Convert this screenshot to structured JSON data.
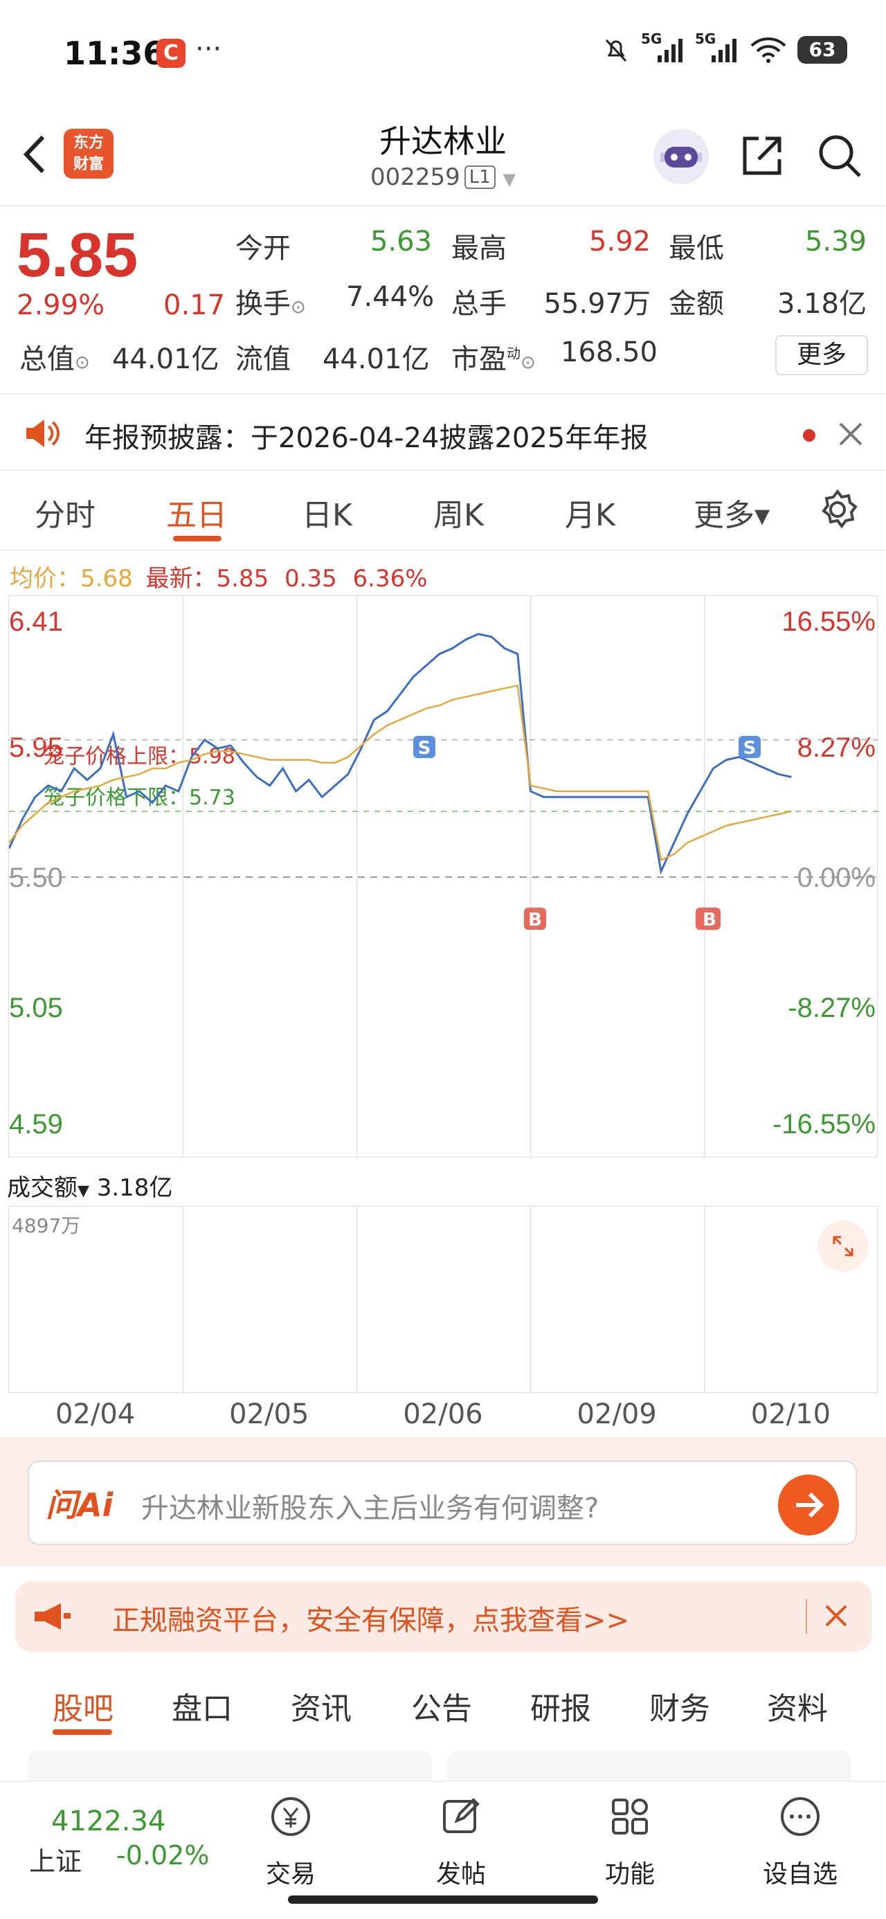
{
  "status_bar": {
    "time": "11:36",
    "app_badge": "C",
    "more": "···",
    "signal_1": "5G",
    "signal_2": "5G",
    "battery": "63"
  },
  "header": {
    "title": "升达林业",
    "code": "002259",
    "level": "L1",
    "logo_line1": "东方",
    "logo_line2": "财富"
  },
  "quote": {
    "price": "5.85",
    "change_pct": "2.99%",
    "change": "0.17",
    "rows": [
      [
        {
          "label": "今开",
          "value": "5.63",
          "color": "green"
        },
        {
          "label": "最高",
          "value": "5.92",
          "color": "red"
        },
        {
          "label": "最低",
          "value": "5.39",
          "color": "green"
        }
      ],
      [
        {
          "label": "换手",
          "value": "7.44%",
          "color": "dark"
        },
        {
          "label": "总手",
          "value": "55.97万",
          "color": "dark"
        },
        {
          "label": "金额",
          "value": "3.18亿",
          "color": "dark"
        }
      ]
    ],
    "total_mv_label": "总值",
    "total_mv": "44.01亿",
    "float_mv_label": "流值",
    "float_mv": "44.01亿",
    "pe_label": "市盈",
    "pe_sup": "动",
    "pe": "168.50",
    "more_button": "更多"
  },
  "notice": {
    "text": "年报预披露：于2026-04-24披露2025年年报"
  },
  "tabs": [
    "分时",
    "五日",
    "日K",
    "周K",
    "月K",
    "更多▾"
  ],
  "active_tab": 1,
  "avg_line": {
    "avg_label": "均价：",
    "avg": "5.68",
    "latest_label": "最新：",
    "latest": "5.85",
    "change": "0.35",
    "change_pct": "6.36%"
  },
  "chart_data": {
    "type": "line",
    "title": "",
    "x_labels": [
      "02/04",
      "02/05",
      "02/06",
      "02/09",
      "02/10"
    ],
    "y_left_ticks": [
      "6.41",
      "5.95",
      "5.50",
      "5.05",
      "4.59"
    ],
    "y_right_ticks": [
      "16.55%",
      "8.27%",
      "0.00%",
      "-8.27%",
      "-16.55%"
    ],
    "ylim": [
      4.59,
      6.41
    ],
    "prev_close": 5.5,
    "series": [
      {
        "values": [
          5.6,
          5.7,
          5.78,
          5.82,
          5.8,
          5.88,
          5.84,
          5.88,
          6.0,
          5.78,
          5.8,
          5.76,
          5.82,
          5.8,
          5.92,
          5.98,
          5.95,
          5.96,
          5.9,
          5.85,
          5.82,
          5.88,
          5.8,
          5.84,
          5.78,
          5.82,
          5.86,
          5.95,
          6.05,
          6.08,
          6.14,
          6.2,
          6.24,
          6.28,
          6.3,
          6.33,
          6.35,
          6.34,
          6.3,
          6.28,
          5.8,
          5.78,
          5.78,
          5.78,
          5.78,
          5.78,
          5.78,
          5.78,
          5.78,
          5.78,
          5.52,
          5.62,
          5.72,
          5.8,
          5.88,
          5.91,
          5.92,
          5.9,
          5.88,
          5.86,
          5.85
        ]
      },
      {
        "values": [
          5.62,
          5.68,
          5.72,
          5.76,
          5.78,
          5.8,
          5.81,
          5.82,
          5.84,
          5.85,
          5.86,
          5.88,
          5.88,
          5.9,
          5.91,
          5.93,
          5.94,
          5.94,
          5.93,
          5.92,
          5.91,
          5.91,
          5.91,
          5.91,
          5.9,
          5.9,
          5.92,
          5.96,
          6.0,
          6.03,
          6.05,
          6.07,
          6.09,
          6.1,
          6.12,
          6.13,
          6.14,
          6.15,
          6.16,
          6.17,
          5.82,
          5.81,
          5.8,
          5.8,
          5.8,
          5.8,
          5.8,
          5.8,
          5.8,
          5.8,
          5.56,
          5.58,
          5.62,
          5.64,
          5.66,
          5.68,
          5.69,
          5.7,
          5.71,
          5.72,
          5.73
        ]
      }
    ],
    "cage_upper_label": "笼子价格上限：5.98",
    "cage_lower_label": "笼子价格下限：5.73",
    "cage_upper": 5.98,
    "cage_lower": 5.73,
    "markers": [
      "S",
      "B",
      "S",
      "B",
      "B",
      "B"
    ],
    "volume_label": "成交额",
    "volume_total": "3.18亿",
    "volume_max": "4897万"
  },
  "ask_ai": {
    "brand": "问Ai",
    "question": "升达林业新股东入主后业务有何调整?"
  },
  "ad": {
    "text": "正规融资平台，安全有保障，点我查看>>"
  },
  "bottom_tabs": [
    "股吧",
    "盘口",
    "资讯",
    "公告",
    "研报",
    "财务",
    "资料"
  ],
  "bottom_nav": {
    "index_value": "4122.34",
    "index_name": "上证",
    "index_change": "-0.02%",
    "items": [
      "交易",
      "发帖",
      "功能",
      "设自选"
    ]
  },
  "colors": {
    "accent": "#e0531f",
    "up": "#d8342c",
    "down": "#3a9a30",
    "price_line": "#3b6fc4",
    "avg_line": "#e6a83a"
  }
}
